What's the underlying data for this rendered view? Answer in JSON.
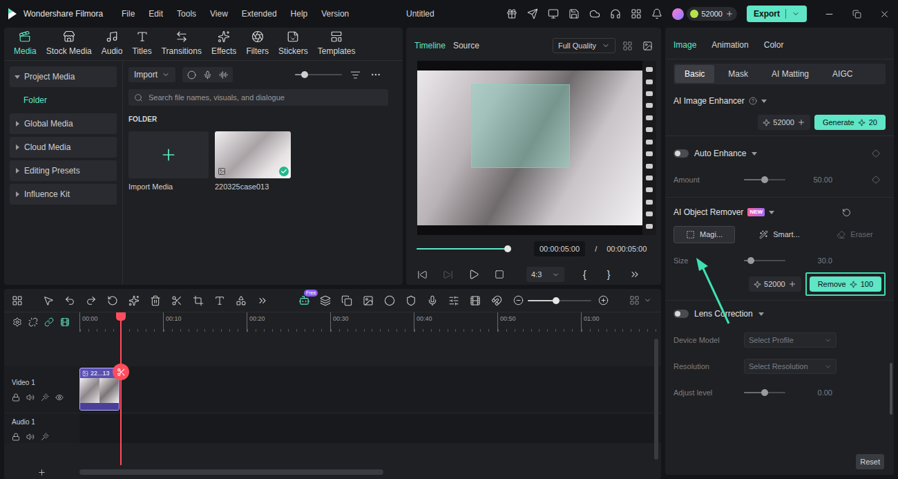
{
  "app": {
    "name": "Wondershare Filmora",
    "project_title": "Untitled"
  },
  "menu": [
    "File",
    "Edit",
    "Tools",
    "View",
    "Extended",
    "Help",
    "Version"
  ],
  "credits": "52000",
  "export": "Export",
  "media_tabs": [
    {
      "label": "Media",
      "selected": true
    },
    {
      "label": "Stock Media",
      "selected": false
    },
    {
      "label": "Audio",
      "selected": false
    },
    {
      "label": "Titles",
      "selected": false
    },
    {
      "label": "Transitions",
      "selected": false
    },
    {
      "label": "Effects",
      "selected": false
    },
    {
      "label": "Filters",
      "selected": false
    },
    {
      "label": "Stickers",
      "selected": false
    },
    {
      "label": "Templates",
      "selected": false
    }
  ],
  "sidebar": [
    {
      "label": "Project Media",
      "expanded": true,
      "children": [
        {
          "label": "Folder",
          "selected": true
        }
      ]
    },
    {
      "label": "Global Media",
      "expanded": false,
      "children": []
    },
    {
      "label": "Cloud Media",
      "expanded": false,
      "children": []
    },
    {
      "label": "Editing Presets",
      "expanded": false,
      "children": []
    },
    {
      "label": "Influence Kit",
      "expanded": false,
      "children": []
    }
  ],
  "media_toolbar": {
    "import": "Import",
    "zoom_level": 0.2,
    "search_placeholder": "Search file names, visuals, and dialogue"
  },
  "folder_heading": "FOLDER",
  "media_items": [
    {
      "kind": "import",
      "label": "Import Media",
      "added": false
    },
    {
      "kind": "clip",
      "label": "220325case013",
      "added": true
    }
  ],
  "preview": {
    "tabs": [
      {
        "label": "Timeline",
        "selected": true
      },
      {
        "label": "Source",
        "selected": false
      }
    ],
    "quality": "Full Quality",
    "progress": 1,
    "current_time": "00:00:05:00",
    "separator": "/",
    "total_time": "00:00:05:00",
    "aspect": "4:3",
    "mark_in": "{",
    "mark_out": "}"
  },
  "inspector": {
    "tabs": [
      {
        "label": "Image",
        "selected": true
      },
      {
        "label": "Animation",
        "selected": false
      },
      {
        "label": "Color",
        "selected": false
      }
    ],
    "subtabs": [
      {
        "label": "Basic",
        "selected": true
      },
      {
        "label": "Mask",
        "selected": false
      },
      {
        "label": "AI Matting",
        "selected": false
      },
      {
        "label": "AIGC",
        "selected": false
      }
    ],
    "enhancer": {
      "title": "AI Image Enhancer",
      "credits": "52000",
      "action": "Generate",
      "cost": "20"
    },
    "auto_enhance": {
      "label": "Auto Enhance",
      "on": false,
      "amount_label": "Amount",
      "amount": "50.00",
      "level": 0.5
    },
    "object_remover": {
      "title": "AI Object Remover",
      "badge": "NEW",
      "tools": [
        {
          "label": "Magi...",
          "selected": true,
          "disabled": false,
          "annotated": true
        },
        {
          "label": "Smart...",
          "selected": false,
          "disabled": false,
          "annotated": false
        },
        {
          "label": "Eraser",
          "selected": false,
          "disabled": true,
          "annotated": false
        }
      ],
      "size_label": "Size",
      "size": "30.0",
      "size_level": 0.17,
      "credits": "52000",
      "action": "Remove",
      "cost": "100",
      "highlighted": true
    },
    "lens": {
      "label": "Lens Correction",
      "on": false,
      "disabled": true,
      "fields": [
        {
          "label": "Device Model",
          "placeholder": "Select Profile"
        },
        {
          "label": "Resolution",
          "placeholder": "Select Resolution"
        }
      ],
      "adjust_label": "Adjust level",
      "adjust": "0.00",
      "adjust_level": 0.5
    },
    "reset": "Reset"
  },
  "timeline": {
    "free_badge": "Free",
    "zoom_level": 0.45,
    "ruler": [
      "00:00",
      "00:10",
      "00:20",
      "00:30",
      "00:40",
      "00:50",
      "01:00"
    ],
    "tracks": [
      {
        "name": "Video 1",
        "kind": "video",
        "clips": [
          {
            "label": "22...13"
          }
        ]
      },
      {
        "name": "Audio 1",
        "kind": "audio",
        "clips": []
      }
    ]
  }
}
